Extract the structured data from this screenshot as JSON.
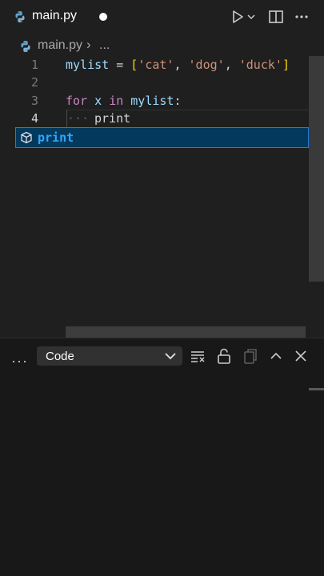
{
  "tab": {
    "title": "main.py",
    "dirty": true
  },
  "toolbar": {
    "run_icon": "play-icon",
    "chevron_icon": "chevron-down-icon",
    "split_icon": "split-editor-icon",
    "more_icon": "more-icon"
  },
  "breadcrumb": {
    "file": "main.py",
    "separator": "›",
    "more": "..."
  },
  "editor": {
    "lines": [
      {
        "number": "1"
      },
      {
        "number": "2"
      },
      {
        "number": "3"
      },
      {
        "number": "4"
      }
    ],
    "code": {
      "l1_var": "mylist",
      "l1_eq": " = ",
      "l1_open": "[",
      "l1_s1": "'cat'",
      "l1_c1": ", ",
      "l1_s2": "'dog'",
      "l1_c2": ", ",
      "l1_s3": "'duck'",
      "l1_close": "]",
      "l3_for": "for",
      "l3_x": " x ",
      "l3_in": "in",
      "l3_list": " mylist",
      "l3_colon": ":",
      "l4_indent": "···",
      "l4_text": "print"
    },
    "active_line": "4"
  },
  "suggest": {
    "label": "print",
    "icon": "cube-icon"
  },
  "panel": {
    "more": "···",
    "dropdown_value": "Code",
    "icons": [
      "clear-output-icon",
      "unlock-icon",
      "copy-icon",
      "chevron-up-icon",
      "close-icon"
    ]
  },
  "colors": {
    "background": "#1f1f1f",
    "panel": "#181818",
    "keyword": "#c586c0",
    "variable": "#9cdcfe",
    "string": "#ce9178",
    "suggest_bg": "#04395e"
  }
}
